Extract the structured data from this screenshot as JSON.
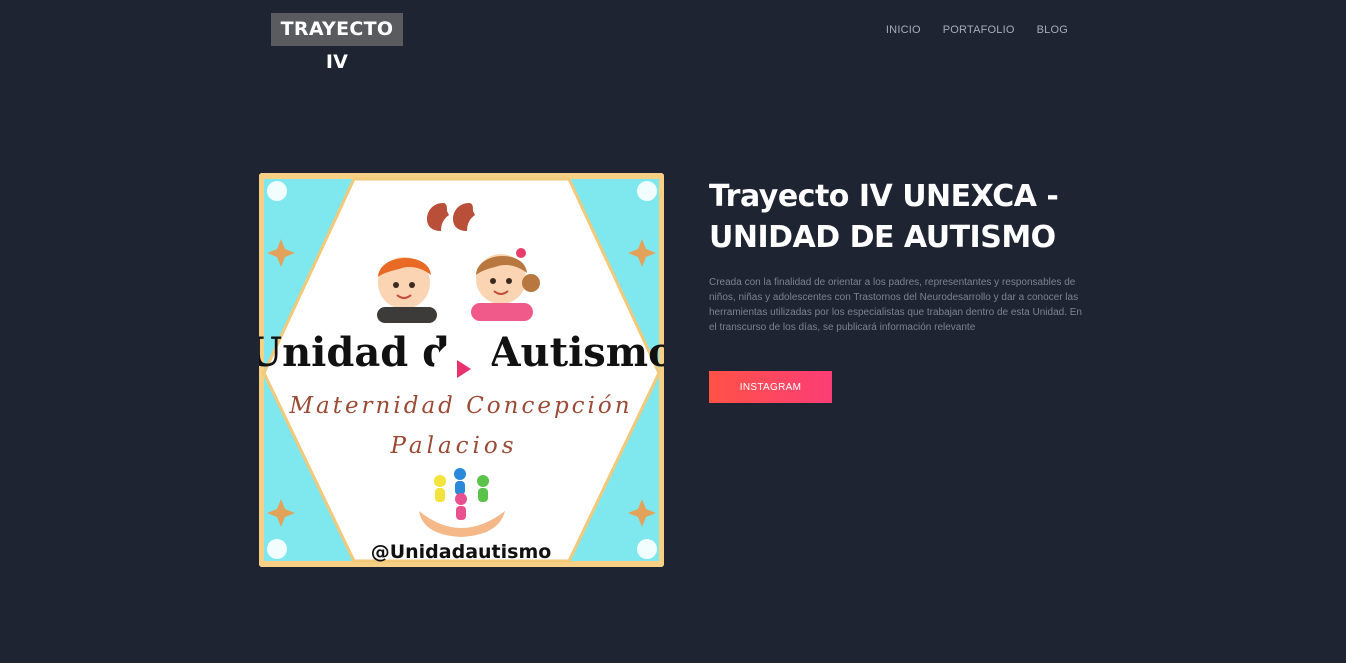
{
  "header": {
    "logo": "TRAYECTO IV",
    "nav": [
      "INICIO",
      "PORTAFOLIO",
      "BLOG"
    ]
  },
  "hero": {
    "title": "Trayecto IV UNEXCA - UNIDAD DE AUTISMO",
    "description": "Creada con la finalidad de orientar a los padres, representantes y responsables de niños, niñas y adolescentes con Trastornos del Neurodesarrollo y dar a conocer las herramientas utilizadas por los especialistas que trabajan dentro de esta Unidad. En el transcurso de los días, se publicará información relevante",
    "button": "INSTAGRAM"
  },
  "poster": {
    "heading": "Unidad de Autismo",
    "subtitle_line1": "Maternidad Concepción",
    "subtitle_line2": "Palacios",
    "handle": "@Unidadautismo"
  },
  "colors": {
    "background": "#1f2432",
    "button_start": "#ff5247",
    "button_end": "#fb3d76",
    "poster_frame": "#f7cf85",
    "poster_accent": "#7fe8ef"
  }
}
